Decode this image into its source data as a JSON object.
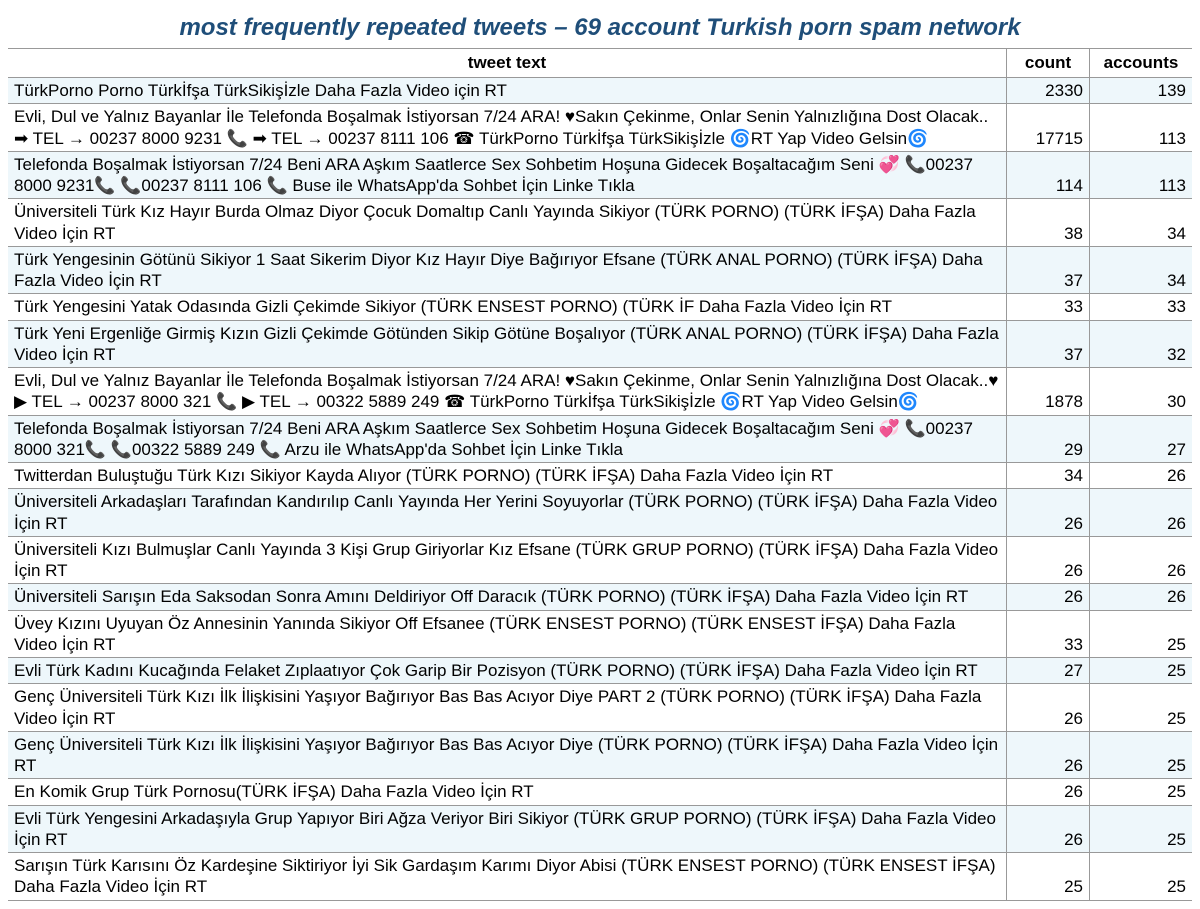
{
  "title": "most frequently repeated tweets – 69 account Turkish porn spam network",
  "headers": {
    "text": "tweet text",
    "count": "count",
    "accounts": "accounts"
  },
  "rows": [
    {
      "text": "TürkPorno Porno Türkİfşa TürkSikişİzle Daha Fazla Video için RT",
      "count": "2330",
      "accounts": "139"
    },
    {
      "text": "Evli, Dul ve Yalnız Bayanlar İle Telefonda Boşalmak İstiyorsan 7/24 ARA! ♥Sakın Çekinme, Onlar Senin Yalnızlığına Dost Olacak.. ➡ TEL → 00237 8000 9231 📞 ➡ TEL → 00237 8111 106 ☎ TürkPorno Türkİfşa TürkSikişİzle 🌀RT Yap Video Gelsin🌀",
      "count": "17715",
      "accounts": "113"
    },
    {
      "text": "Telefonda Boşalmak İstiyorsan 7/24 Beni ARA Aşkım Saatlerce Sex Sohbetim Hoşuna Gidecek Boşaltacağım Seni 💞 📞00237 8000 9231📞 📞00237 8111 106 📞 Buse ile WhatsApp'da Sohbet İçin Linke Tıkla",
      "count": "114",
      "accounts": "113"
    },
    {
      "text": "Üniversiteli Türk Kız Hayır Burda Olmaz Diyor Çocuk Domaltıp Canlı Yayında Sikiyor (TÜRK PORNO) (TÜRK İFŞA) Daha Fazla Video İçin RT",
      "count": "38",
      "accounts": "34"
    },
    {
      "text": "Türk Yengesinin Götünü Sikiyor 1 Saat Sikerim Diyor Kız Hayır Diye Bağırıyor Efsane (TÜRK ANAL PORNO) (TÜRK İFŞA) Daha Fazla Video İçin RT",
      "count": "37",
      "accounts": "34"
    },
    {
      "text": "Türk Yengesini Yatak Odasında Gizli Çekimde Sikiyor (TÜRK ENSEST PORNO) (TÜRK İF Daha Fazla Video İçin RT",
      "count": "33",
      "accounts": "33"
    },
    {
      "text": "Türk Yeni Ergenliğe Girmiş Kızın Gizli Çekimde Götünden Sikip Götüne Boşalıyor (TÜRK ANAL PORNO) (TÜRK İFŞA) Daha Fazla Video İçin RT",
      "count": "37",
      "accounts": "32"
    },
    {
      "text": "Evli, Dul ve Yalnız Bayanlar İle Telefonda Boşalmak İstiyorsan 7/24 ARA! ♥Sakın Çekinme, Onlar Senin Yalnızlığına Dost Olacak..♥ ▶ TEL → 00237 8000 321 📞 ▶ TEL → 00322 5889 249 ☎ TürkPorno Türkİfşa TürkSikişİzle 🌀RT Yap Video Gelsin🌀",
      "count": "1878",
      "accounts": "30"
    },
    {
      "text": "Telefonda Boşalmak İstiyorsan 7/24 Beni ARA Aşkım Saatlerce Sex Sohbetim Hoşuna Gidecek Boşaltacağım Seni 💞 📞00237 8000 321📞 📞00322 5889 249 📞 Arzu ile WhatsApp'da Sohbet İçin Linke Tıkla",
      "count": "29",
      "accounts": "27"
    },
    {
      "text": "Twitterdan Buluştuğu Türk Kızı Sikiyor Kayda Alıyor (TÜRK PORNO) (TÜRK İFŞA) Daha Fazla Video İçin RT",
      "count": "34",
      "accounts": "26"
    },
    {
      "text": "Üniversiteli Arkadaşları Tarafından Kandırılıp Canlı Yayında Her Yerini Soyuyorlar (TÜRK PORNO) (TÜRK İFŞA) Daha Fazla Video İçin RT",
      "count": "26",
      "accounts": "26"
    },
    {
      "text": "Üniversiteli Kızı Bulmuşlar Canlı Yayında 3 Kişi Grup Giriyorlar Kız Efsane (TÜRK GRUP PORNO) (TÜRK İFŞA) Daha Fazla Video İçin RT",
      "count": "26",
      "accounts": "26"
    },
    {
      "text": "Üniversiteli Sarışın Eda Saksodan Sonra Amını Deldiriyor Off Daracık (TÜRK PORNO) (TÜRK İFŞA) Daha Fazla Video İçin RT",
      "count": "26",
      "accounts": "26"
    },
    {
      "text": "Üvey Kızını Uyuyan Öz Annesinin Yanında Sikiyor Off Efsanee (TÜRK ENSEST PORNO) (TÜRK ENSEST İFŞA) Daha Fazla Video İçin RT",
      "count": "33",
      "accounts": "25"
    },
    {
      "text": "Evli Türk Kadını Kucağında Felaket Zıplaatıyor Çok Garip Bir Pozisyon (TÜRK PORNO) (TÜRK İFŞA) Daha Fazla Video İçin RT",
      "count": "27",
      "accounts": "25"
    },
    {
      "text": "Genç Üniversiteli Türk Kızı İlk İlişkisini Yaşıyor Bağırıyor Bas Bas Acıyor Diye PART 2 (TÜRK PORNO) (TÜRK İFŞA) Daha Fazla Video İçin RT",
      "count": "26",
      "accounts": "25"
    },
    {
      "text": "Genç Üniversiteli Türk Kızı İlk İlişkisini Yaşıyor Bağırıyor Bas Bas Acıyor Diye (TÜRK PORNO) (TÜRK İFŞA) Daha Fazla Video İçin RT",
      "count": "26",
      "accounts": "25"
    },
    {
      "text": "En Komik Grup Türk Pornosu(TÜRK İFŞA) Daha Fazla Video İçin RT",
      "count": "26",
      "accounts": "25"
    },
    {
      "text": "Evli Türk Yengesini Arkadaşıyla Grup Yapıyor Biri Ağza Veriyor Biri Sikiyor (TÜRK GRUP PORNO) (TÜRK İFŞA) Daha Fazla Video İçin RT",
      "count": "26",
      "accounts": "25"
    },
    {
      "text": "Sarışın Türk Karısını Öz Kardeşine Siktiriyor İyi Sik Gardaşım Karımı Diyor Abisi (TÜRK ENSEST PORNO) (TÜRK ENSEST İFŞA) Daha Fazla Video İçin RT",
      "count": "25",
      "accounts": "25"
    }
  ]
}
